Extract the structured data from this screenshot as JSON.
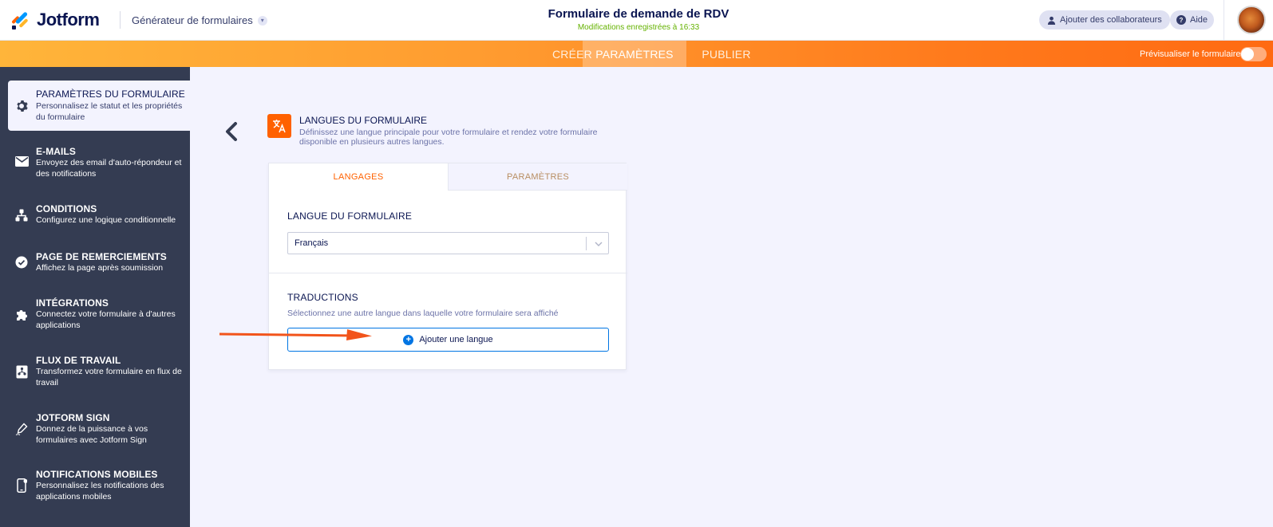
{
  "header": {
    "logo_text": "Jotform",
    "builder_menu": "Générateur de formulaires",
    "form_title": "Formulaire de demande de RDV",
    "saved_status": "Modifications enregistrées à 16:33",
    "collaborators_button": "Ajouter des collaborateurs",
    "help_button": "Aide"
  },
  "nav": {
    "tabs": [
      {
        "label": "CRÉER",
        "active": false
      },
      {
        "label": "PARAMÈTRES",
        "active": true
      },
      {
        "label": "PUBLIER",
        "active": false
      }
    ],
    "preview_label": "Prévisualiser le formulaire"
  },
  "sidebar": {
    "items": [
      {
        "title": "PARAMÈTRES DU FORMULAIRE",
        "desc": "Personnalisez le statut et les propriétés du formulaire",
        "icon": "gear-icon",
        "active": true
      },
      {
        "title": "E-MAILS",
        "desc": "Envoyez des email d'auto-répondeur et des notifications",
        "icon": "envelope-icon",
        "active": false
      },
      {
        "title": "CONDITIONS",
        "desc": "Configurez une logique conditionnelle",
        "icon": "hierarchy-icon",
        "active": false
      },
      {
        "title": "PAGE DE REMERCIEMENTS",
        "desc": "Affichez la page après soumission",
        "icon": "check-circle-icon",
        "active": false
      },
      {
        "title": "INTÉGRATIONS",
        "desc": "Connectez votre formulaire à d'autres applications",
        "icon": "puzzle-icon",
        "active": false
      },
      {
        "title": "FLUX DE TRAVAIL",
        "desc": "Transformez votre formulaire en flux de travail",
        "icon": "workflow-icon",
        "active": false
      },
      {
        "title": "JOTFORM SIGN",
        "desc": "Donnez de la puissance à vos formulaires avec Jotform Sign",
        "icon": "pen-icon",
        "active": false
      },
      {
        "title": "NOTIFICATIONS MOBILES",
        "desc": "Personnalisez les notifications des applications mobiles",
        "icon": "mobile-icon",
        "active": false
      }
    ]
  },
  "section": {
    "title": "LANGUES DU FORMULAIRE",
    "desc": "Définissez une langue principale pour votre formulaire et rendez votre formulaire disponible en plusieurs autres langues.",
    "icon": "translate-icon"
  },
  "panel": {
    "tabs": [
      {
        "label": "LANGAGES",
        "active": true
      },
      {
        "label": "PARAMÈTRES",
        "active": false
      }
    ],
    "form_language_label": "LANGUE DU FORMULAIRE",
    "form_language_value": "Français",
    "translations_label": "TRADUCTIONS",
    "translations_desc": "Sélectionnez une autre langue dans laquelle votre formulaire sera affiché",
    "add_language_button": "Ajouter une langue"
  },
  "colors": {
    "brand_orange": "#ff6100",
    "sidebar_bg": "#343c52",
    "accent_blue": "#0075e3",
    "saved_green": "#64b200"
  }
}
